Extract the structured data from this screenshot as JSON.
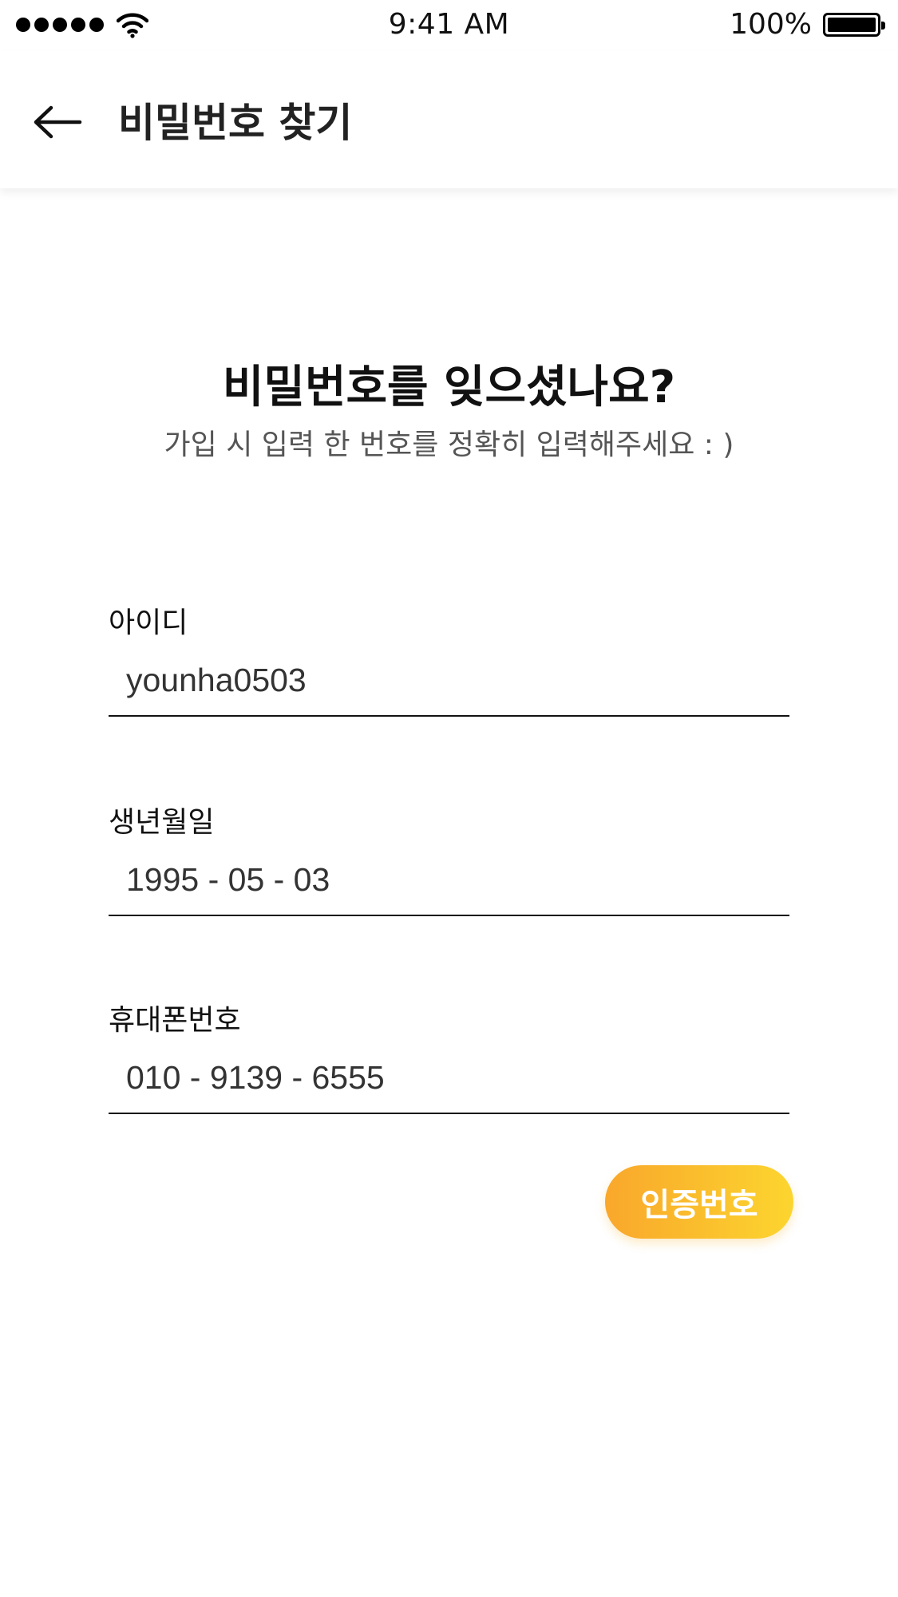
{
  "status_bar": {
    "time": "9:41 AM",
    "battery_percent": "100%",
    "battery_level": 1.0,
    "signal_bars": 5,
    "icons": [
      "signal-dots-icon",
      "wifi-icon",
      "battery-icon"
    ]
  },
  "header": {
    "back_icon": "arrow-left-icon",
    "title": "비밀번호 찾기"
  },
  "main": {
    "heading": "비밀번호를 잊으셨나요?",
    "subheading": "가입 시 입력 한 번호를 정확히 입력해주세요 : )"
  },
  "form": {
    "id": {
      "label": "아이디",
      "value": "younha0503"
    },
    "birthdate": {
      "label": "생년월일",
      "value": "1995 - 05 - 03"
    },
    "phone": {
      "label": "휴대폰번호",
      "value": "010 - 9139 - 6555"
    },
    "verify_button_label": "인증번호"
  },
  "colors": {
    "accent_gradient_start": "#f9a72b",
    "accent_gradient_end": "#fcd52f",
    "text_primary": "#111111",
    "text_secondary": "#555555"
  }
}
